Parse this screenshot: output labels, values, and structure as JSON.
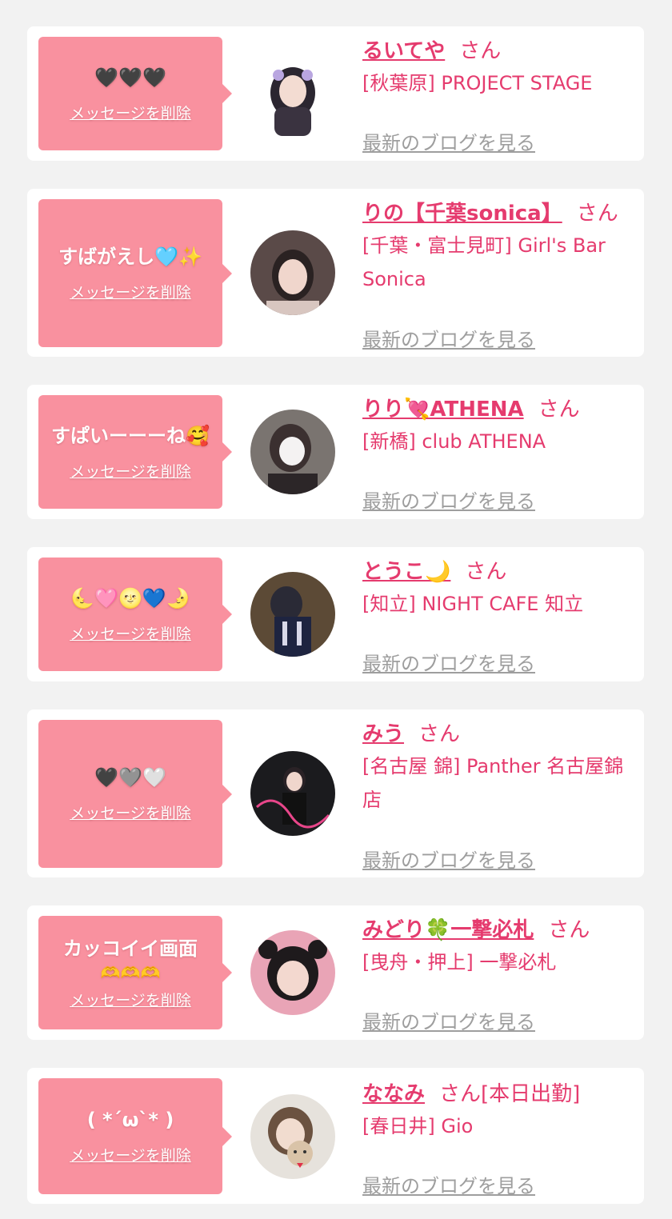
{
  "delete_label": "メッセージを削除",
  "san_label": "さん",
  "blog_label": "最新のブログを見る",
  "colors": {
    "bubble": "#f9919f",
    "accent": "#e53b6e",
    "link_gray": "#9e9e9e",
    "background": "#f2f2f2"
  },
  "entries": [
    {
      "message": "🖤🖤🖤",
      "name": "るいてや",
      "san": "さん",
      "shop": "[秋葉原] PROJECT STAGE"
    },
    {
      "message": "すばがえし🩵✨",
      "name": "りの【千葉sonica】",
      "san": "さん",
      "shop": "[千葉・富士見町] Girl's Bar Sonica"
    },
    {
      "message": "すぱいーーーね🥰",
      "name": "りり💘ATHENA",
      "san": "さん",
      "shop": "[新橋] club ATHENA"
    },
    {
      "message": "🌜🩷🌝💙🌛",
      "name": "とうこ🌙",
      "san": "さん",
      "shop": "[知立] NIGHT CAFE 知立"
    },
    {
      "message": "🖤🩶🤍",
      "name": "みう",
      "san": "さん",
      "shop": "[名古屋 錦] Panther 名古屋錦店"
    },
    {
      "message": "カッコイイ画面",
      "message_sub": "🫶🫶🫶",
      "name": "みどり🍀一撃必札",
      "san": "さん",
      "shop": "[曳舟・押上] 一撃必札"
    },
    {
      "message": "( *´ω`* )",
      "name": "ななみ",
      "san": "さん[本日出勤]",
      "shop": "[春日井] Gio"
    }
  ]
}
